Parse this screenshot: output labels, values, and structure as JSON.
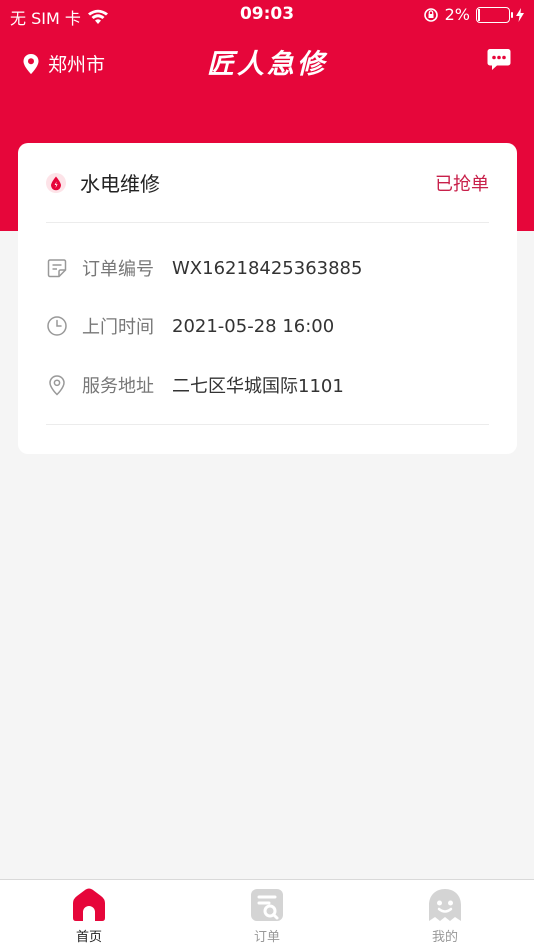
{
  "status_bar": {
    "carrier": "无 SIM 卡",
    "time": "09:03",
    "battery": "2%"
  },
  "header": {
    "city": "郑州市",
    "brand": "匠人急修",
    "icons": {
      "location": "location-pin-icon",
      "message": "message-bubble-icon"
    }
  },
  "order": {
    "service_name": "水电维修",
    "status": "已抢单",
    "rows": [
      {
        "label": "订单编号",
        "value": "WX16218425363885",
        "icon": "order-note-icon"
      },
      {
        "label": "上门时间",
        "value": "2021-05-28 16:00",
        "icon": "clock-icon"
      },
      {
        "label": "服务地址",
        "value": "二七区华城国际1101",
        "icon": "location-pin-icon"
      }
    ]
  },
  "tabs": [
    {
      "label": "首页",
      "active": true,
      "icon": "home-icon"
    },
    {
      "label": "订单",
      "active": false,
      "icon": "order-icon"
    },
    {
      "label": "我的",
      "active": false,
      "icon": "profile-icon"
    }
  ],
  "colors": {
    "brand_red": "#e6063a",
    "status_text": "#c8204a",
    "inactive_icon": "#d4d4d4"
  }
}
